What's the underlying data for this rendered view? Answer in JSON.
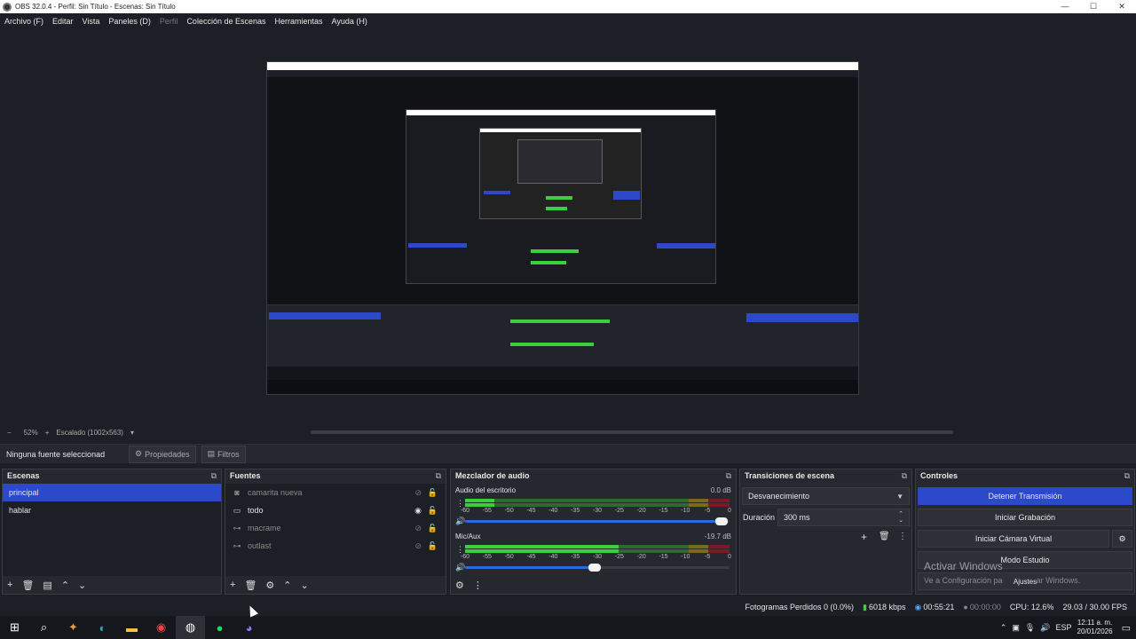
{
  "window": {
    "title": "OBS 32.0.4 - Perfil: Sin Título - Escenas: Sin Título"
  },
  "menu": {
    "items": [
      {
        "label": "Archivo (F)",
        "enabled": true
      },
      {
        "label": "Editar",
        "enabled": true
      },
      {
        "label": "Vista",
        "enabled": true
      },
      {
        "label": "Paneles (D)",
        "enabled": true
      },
      {
        "label": "Perfil",
        "enabled": false
      },
      {
        "label": "Colección de Escenas",
        "enabled": true
      },
      {
        "label": "Herramientas",
        "enabled": true
      },
      {
        "label": "Ayuda (H)",
        "enabled": true
      }
    ]
  },
  "zoom": {
    "minus": "−",
    "value": "52%",
    "plus": "+",
    "mode": "Escalado (1002x563)"
  },
  "props": {
    "no_source": "Ninguna fuente seleccionad",
    "properties": "Propiedades",
    "filters": "Filtros"
  },
  "scenes": {
    "title": "Escenas",
    "items": [
      "principal",
      "hablar"
    ],
    "selected": 0
  },
  "sources": {
    "title": "Fuentes",
    "items": [
      {
        "name": "camarita nueva",
        "icon": "camera-icon",
        "visible": false
      },
      {
        "name": "todo",
        "icon": "display-icon",
        "visible": true
      },
      {
        "name": "macrame",
        "icon": "gamepad-icon",
        "visible": false
      },
      {
        "name": "outlast",
        "icon": "gamepad-icon",
        "visible": false
      }
    ]
  },
  "mixer": {
    "title": "Mezclador de audio",
    "channels": [
      {
        "name": "Audio del escritorio",
        "db": "0.0 dB",
        "level": 0.11,
        "volume": 0.97
      },
      {
        "name": "Mic/Aux",
        "db": "-19.7 dB",
        "level": 0.58,
        "volume": 0.49
      }
    ],
    "scale": [
      "-60",
      "-55",
      "-50",
      "-45",
      "-40",
      "-35",
      "-30",
      "-25",
      "-20",
      "-15",
      "-10",
      "-5",
      "0"
    ]
  },
  "transitions": {
    "title": "Transiciones de escena",
    "selected": "Desvanecimiento",
    "duration_label": "Duración",
    "duration_value": "300 ms"
  },
  "controls": {
    "title": "Controles",
    "stop_stream": "Detener Transmisión",
    "start_record": "Iniciar Grabación",
    "virtual_cam": "Iniciar Cámara Virtual",
    "studio_mode": "Modo Estudio",
    "settings": "Ajustes",
    "accent": "#2b49c8"
  },
  "watermark": {
    "line1": "Activar Windows",
    "line2_pre": "Ve a Configuración pa",
    "line2_post": "ar Windows."
  },
  "status": {
    "dropped": "Fotogramas Perdidos 0 (0.0%)",
    "bitrate": "6018 kbps",
    "stream_time": "00:55:21",
    "rec_time": "00:00:00",
    "cpu": "CPU: 12.6%",
    "fps": "29.03 / 30.00 FPS"
  },
  "taskbar": {
    "lang": "ESP",
    "time": "12:11 a. m.",
    "date": "20/01/2026"
  }
}
